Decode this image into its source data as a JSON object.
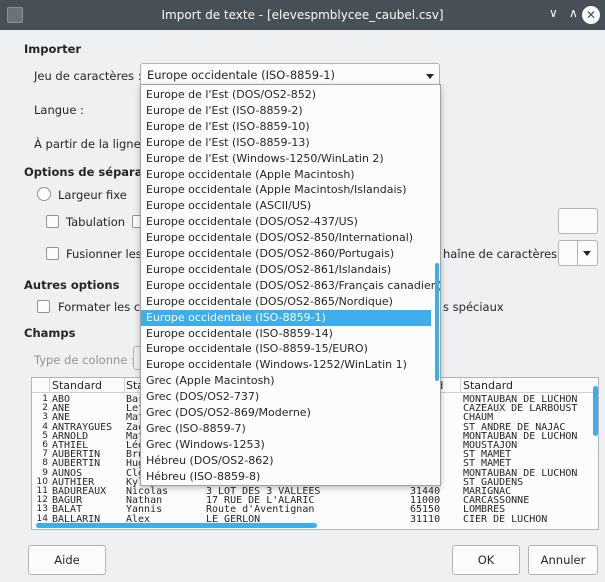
{
  "window": {
    "title": "Import de texte - [elevespmblycee_caubel.csv]",
    "minimize_glyph": "∨",
    "maximize_glyph": "∧",
    "close_glyph": "✕"
  },
  "import": {
    "heading": "Importer",
    "charset_label": "Jeu de caractères :",
    "charset_value": "Europe occidentale (ISO-8859-1)",
    "language_label": "Langue :",
    "from_line_label": "À partir de la ligne :"
  },
  "separators": {
    "heading_visible": "Options de séparateu",
    "fixed_width": "Largeur fixe",
    "tab": "Tabulation",
    "tab_next_visible": "",
    "merge_visible": "Fusionner les s",
    "string_delim_visible": "haîne de caractères :"
  },
  "other": {
    "heading": "Autres options",
    "format_visible": "Formater les char",
    "special_visible": "s spéciaux"
  },
  "fields": {
    "heading": "Champs",
    "column_type_label": "Type de colonne :",
    "col_header_1": "Standard",
    "col_header_2": "Sta",
    "col_header_3": "rd",
    "col_header_4": "Standard"
  },
  "preview_rows": [
    {
      "n": "1",
      "c1": "ABO",
      "c2": "Bar",
      "c3": "",
      "c4": "",
      "c5": "MONTAUBAN DE LUCHON"
    },
    {
      "n": "2",
      "c1": "ANE",
      "c2": "Lef",
      "c3": "",
      "c4": "",
      "c5": "CAZEAUX DE LARBOUST"
    },
    {
      "n": "3",
      "c1": "ANE",
      "c2": "Mat",
      "c3": "",
      "c4": "",
      "c5": "CHAUM"
    },
    {
      "n": "4",
      "c1": "ANTRAYGUES",
      "c2": "Zac",
      "c3": "",
      "c4": "",
      "c5": "ST ANDRE DE NAJAC"
    },
    {
      "n": "5",
      "c1": "ARNOLD",
      "c2": "Mat",
      "c3": "",
      "c4": "",
      "c5": "MONTAUBAN DE LUCHON"
    },
    {
      "n": "6",
      "c1": "ATHIEL",
      "c2": "Léo",
      "c3": "",
      "c4": "",
      "c5": "MOUSTAJON"
    },
    {
      "n": "7",
      "c1": "AUBERTIN",
      "c2": "Bru",
      "c3": "",
      "c4": "",
      "c5": "ST MAMET"
    },
    {
      "n": "8",
      "c1": "AUBERTIN",
      "c2": "Hug",
      "c3": "",
      "c4": "",
      "c5": "ST MAMET"
    },
    {
      "n": "9",
      "c1": "AUNOS",
      "c2": "Clé",
      "c3": "",
      "c4": "",
      "c5": "MONTAUBAN DE LUCHON"
    },
    {
      "n": "10",
      "c1": "AUTHIER",
      "c2": "Kyl",
      "c3": "",
      "c4": "",
      "c5": "ST GAUDENS"
    },
    {
      "n": "11",
      "c1": "BADUREAUX",
      "c2": "Nicolas",
      "c3": "3 LOT DES 3 VALLEES",
      "c4": "31440",
      "c5": "MARIGNAC"
    },
    {
      "n": "12",
      "c1": "BAGUR",
      "c2": "Nathan",
      "c3": "17 RUE DE L'ALARIC",
      "c4": "11000",
      "c5": "CARCASSONNE"
    },
    {
      "n": "13",
      "c1": "BALAT",
      "c2": "Yannis",
      "c3": "Route d'Aventignan",
      "c4": "65150",
      "c5": "LOMBRES"
    },
    {
      "n": "14",
      "c1": "BALLARIN",
      "c2": "Alex",
      "c3": "LE GERLON",
      "c4": "31110",
      "c5": "CIER DE LUCHON"
    }
  ],
  "charset_options": [
    "Europe de l'Est (DOS/OS2-852)",
    "Europe de l'Est (ISO-8859-2)",
    "Europe de l'Est (ISO-8859-10)",
    "Europe de l'Est (ISO-8859-13)",
    "Europe de l'Est (Windows-1250/WinLatin 2)",
    "Europe occidentale (Apple Macintosh)",
    "Europe occidentale (Apple Macintosh/Islandais)",
    "Europe occidentale (ASCII/US)",
    "Europe occidentale (DOS/OS2-437/US)",
    "Europe occidentale (DOS/OS2-850/International)",
    "Europe occidentale (DOS/OS2-860/Portugais)",
    "Europe occidentale (DOS/OS2-861/Islandais)",
    "Europe occidentale (DOS/OS2-863/Français canadien)",
    "Europe occidentale (DOS/OS2-865/Nordique)",
    "Europe occidentale (ISO-8859-1)",
    "Europe occidentale (ISO-8859-14)",
    "Europe occidentale (ISO-8859-15/EURO)",
    "Europe occidentale (Windows-1252/WinLatin 1)",
    "Grec (Apple Macintosh)",
    "Grec (DOS/OS2-737)",
    "Grec (DOS/OS2-869/Moderne)",
    "Grec (ISO-8859-7)",
    "Grec (Windows-1253)",
    "Hébreu (DOS/OS2-862)",
    "Hébreu (ISO-8859-8)"
  ],
  "charset_selected_index": 14,
  "buttons": {
    "help": "Aide",
    "ok": "OK",
    "cancel": "Annuler"
  },
  "colors": {
    "titlebar": "#475057",
    "window_bg": "#eff0f1",
    "selection": "#3daee9",
    "scrollbar": "#3daee9"
  }
}
